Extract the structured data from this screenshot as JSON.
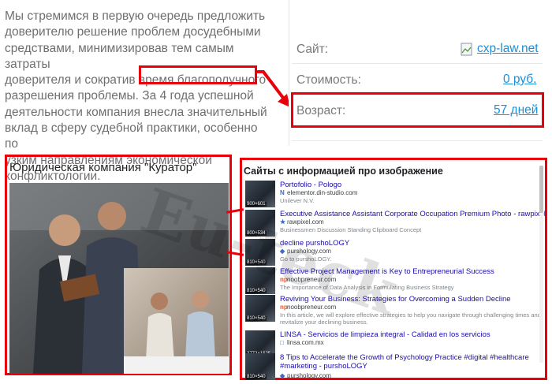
{
  "paragraph": {
    "lines": [
      "Мы стремимся в первую очередь предложить",
      "доверителю решение проблем досудебными",
      "средствами, минимизировав тем самым затраты",
      "доверителя и сократив время благополучного",
      "разрешения проблемы. ",
      "деятельности компания внесла значительный",
      "вклад в сферу судебной практики, особенно по",
      "узким направлениям экономической",
      "конфликтологии."
    ],
    "highlight": "За 4 года успешной"
  },
  "info": {
    "site_label": "Сайт:",
    "site_value": "cxp-law.net",
    "price_label": "Стоимость:",
    "price_value": "0 руб.",
    "age_label": "Возраст:",
    "age_value": "57 дней"
  },
  "company": {
    "title": "Юридическая компания \"Куратор\""
  },
  "results": {
    "title": "Сайты с информацией про изображение",
    "items": [
      {
        "title": "Portofolio - Pologo",
        "source": "elementor.din-studio.com",
        "favicon": "N",
        "desc": "Unilever N.V.",
        "dim": "900×601"
      },
      {
        "title": "Executive Assistance Assistant Corporate Occupation Premium Photo - rawpixel",
        "source": "rawpixel.com",
        "favicon": "★",
        "desc": "Businessmen Discussion Standing Clipboard Concept",
        "dim": "800×534"
      },
      {
        "title": "decline purshoLOGY",
        "source": "purshology.com",
        "favicon": "◆",
        "desc": "Go to purshoLOGY.",
        "dim": "810×540"
      },
      {
        "title": "Effective Project Management is Key to Entrepreneurial Success",
        "source": "noobpreneur.com",
        "favicon": "np",
        "desc": "The Importance of Data Analysis in Formulating Business Strategy",
        "dim": "810×540"
      },
      {
        "title": "Reviving Your Business: Strategies for Overcoming a Sudden Decline",
        "source": "noobpreneur.com",
        "favicon": "np",
        "desc": "In this article, we will explore effective strategies to help you navigate through challenging times and revitalize your declining business.",
        "dim": "810×540"
      },
      {
        "title": "LINSA - Servicios de limpieza integral - Calidad en los servicios",
        "source": "linsa.com.mx",
        "favicon": "□",
        "desc": "",
        "dim": "2772×1525"
      },
      {
        "title": "8 Tips to Accelerate the Growth of Psychology Practice #digital #healthcare #marketing - purshoLOGY",
        "source": "purshology.com",
        "favicon": "◆",
        "desc": "",
        "dim": "810×540"
      }
    ]
  },
  "watermark": "Eu-teck",
  "colors": {
    "highlight_red": "#e8000b",
    "link_blue": "#1d8fd6"
  }
}
